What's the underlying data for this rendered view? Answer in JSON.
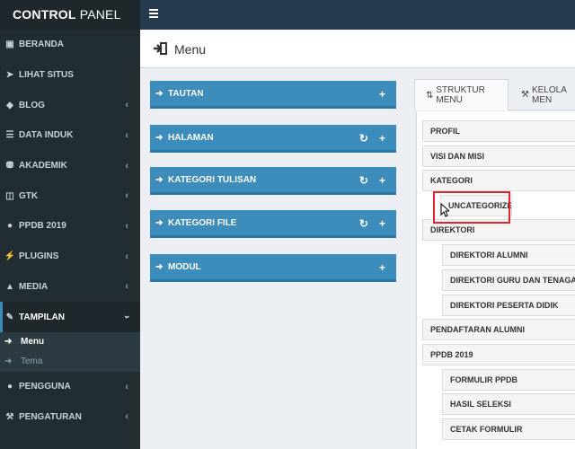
{
  "app": {
    "title_bold": "CONTROL",
    "title_light": " PANEL"
  },
  "sidebar": {
    "items": [
      {
        "label": "BERANDA",
        "icon": "dashboard-icon",
        "has_chevron": false
      },
      {
        "label": "LIHAT SITUS",
        "icon": "rocket-icon",
        "has_chevron": false
      },
      {
        "label": "BLOG",
        "icon": "tag-icon",
        "has_chevron": true
      },
      {
        "label": "DATA INDUK",
        "icon": "list-icon",
        "has_chevron": true
      },
      {
        "label": "AKADEMIK",
        "icon": "database-icon",
        "has_chevron": true
      },
      {
        "label": "GTK",
        "icon": "folder-icon",
        "has_chevron": true
      },
      {
        "label": "PPDB 2019",
        "icon": "group-icon",
        "has_chevron": true
      },
      {
        "label": "PLUGINS",
        "icon": "plug-icon",
        "has_chevron": true
      },
      {
        "label": "MEDIA",
        "icon": "upload-icon",
        "has_chevron": true
      },
      {
        "label": "TAMPILAN",
        "icon": "brush-icon",
        "has_chevron": true,
        "active": true
      }
    ],
    "submenu": [
      {
        "label": "Menu",
        "current": true
      },
      {
        "label": "Tema",
        "current": false
      }
    ],
    "items_after": [
      {
        "label": "PENGGUNA",
        "icon": "users-icon",
        "has_chevron": true
      },
      {
        "label": "PENGATURAN",
        "icon": "wrench-icon",
        "has_chevron": true
      }
    ]
  },
  "header": {
    "title": "Menu",
    "icon": "sign-in-icon"
  },
  "boxes": [
    {
      "label": "TAUTAN",
      "refresh": false
    },
    {
      "label": "HALAMAN",
      "refresh": true
    },
    {
      "label": "KATEGORI TULISAN",
      "refresh": true
    },
    {
      "label": "KATEGORI FILE",
      "refresh": true
    },
    {
      "label": "MODUL",
      "refresh": false
    }
  ],
  "tabs": {
    "active": "STRUKTUR MENU",
    "other": "KELOLA MEN"
  },
  "tree": [
    {
      "label": "PROFIL",
      "level": 0
    },
    {
      "label": "VISI DAN MISI",
      "level": 0
    },
    {
      "label": "KATEGORI",
      "level": 0
    },
    {
      "label": "UNCATEGORIZED",
      "level": 1
    },
    {
      "label": "DIREKTORI",
      "level": 0
    },
    {
      "label": "DIREKTORI ALUMNI",
      "level": 1
    },
    {
      "label": "DIREKTORI GURU DAN TENAGA KEPENDIDIKAN",
      "level": 1
    },
    {
      "label": "DIREKTORI PESERTA DIDIK",
      "level": 1
    },
    {
      "label": "PENDAFTARAN ALUMNI",
      "level": 0
    },
    {
      "label": "PPDB 2019",
      "level": 0
    },
    {
      "label": "FORMULIR PPDB",
      "level": 1
    },
    {
      "label": "HASIL SELEKSI",
      "level": 1
    },
    {
      "label": "CETAK FORMULIR",
      "level": 1
    }
  ],
  "colors": {
    "sidebar": "#222d32",
    "topbar": "#263a4f",
    "box": "#3c8dbc",
    "highlight": "#e0262c"
  }
}
